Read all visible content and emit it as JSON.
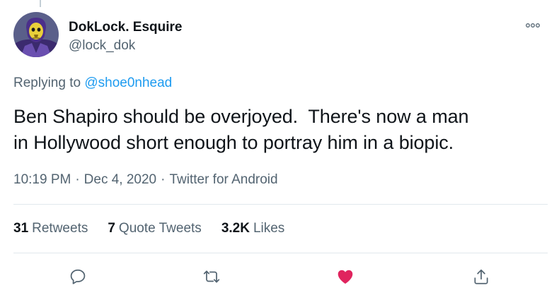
{
  "author": {
    "display_name": "DokLock. Esquire",
    "handle": "@lock_dok"
  },
  "reply": {
    "prefix": "Replying to ",
    "to_handle": "@shoe0nhead"
  },
  "tweet": {
    "line1": "Ben Shapiro should be overjoyed.  There's now a man",
    "line2": "in Hollywood short enough to portray him in a biopic."
  },
  "meta": {
    "time": "10:19 PM",
    "sep": "·",
    "date": "Dec 4, 2020",
    "source": "Twitter for Android"
  },
  "stats": {
    "retweets_count": "31",
    "retweets_label": "Retweets",
    "quotes_count": "7",
    "quotes_label": "Quote Tweets",
    "likes_count": "3.2K",
    "likes_label": "Likes"
  },
  "colors": {
    "link": "#1d9bf0",
    "like": "#e0245e",
    "muted": "#536471",
    "divider": "#e1e8ed"
  },
  "icons": {
    "more": "more-horizontal-icon",
    "reply": "reply-icon",
    "retweet": "retweet-icon",
    "like": "heart-icon",
    "share": "share-icon"
  }
}
